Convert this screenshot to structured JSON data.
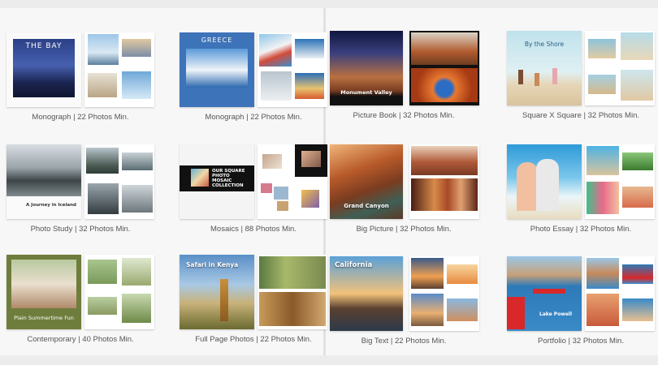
{
  "captions": {
    "monograph_1": "Monograph | 22 Photos Min.",
    "monograph_2": "Monograph | 22 Photos Min.",
    "picture_book": "Picture Book | 32 Photos Min.",
    "square_x_square": "Square X Square | 32 Photos Min.",
    "photo_study": "Photo Study | 32 Photos Min.",
    "mosaics": "Mosaics | 88 Photos Min.",
    "big_picture": "Big Picture | 32 Photos Min.",
    "photo_essay": "Photo Essay | 32 Photos Min.",
    "contemporary": "Contemporary | 40 Photos Min.",
    "full_page_photos": "Full Page Photos | 22 Photos Min.",
    "big_text": "Big Text | 22 Photos Min.",
    "portfolio": "Portfolio | 32 Photos Min."
  },
  "cover_titles": {
    "the_bay": "THE BAY",
    "greece": "GREECE",
    "monument_valley": "Monument Valley",
    "by_the_shore": "By the Shore",
    "journey_iceland": "A Journey in Iceland",
    "mosaic_title": "OUR SQUARE PHOTO MOSAIC COLLECTION",
    "grand_canyon": "Grand Canyon",
    "summertime_fun": "Plain Summertime Fun",
    "safari_kenya": "Safari in Kenya",
    "california": "California",
    "lake_powell": "Lake Powell"
  }
}
